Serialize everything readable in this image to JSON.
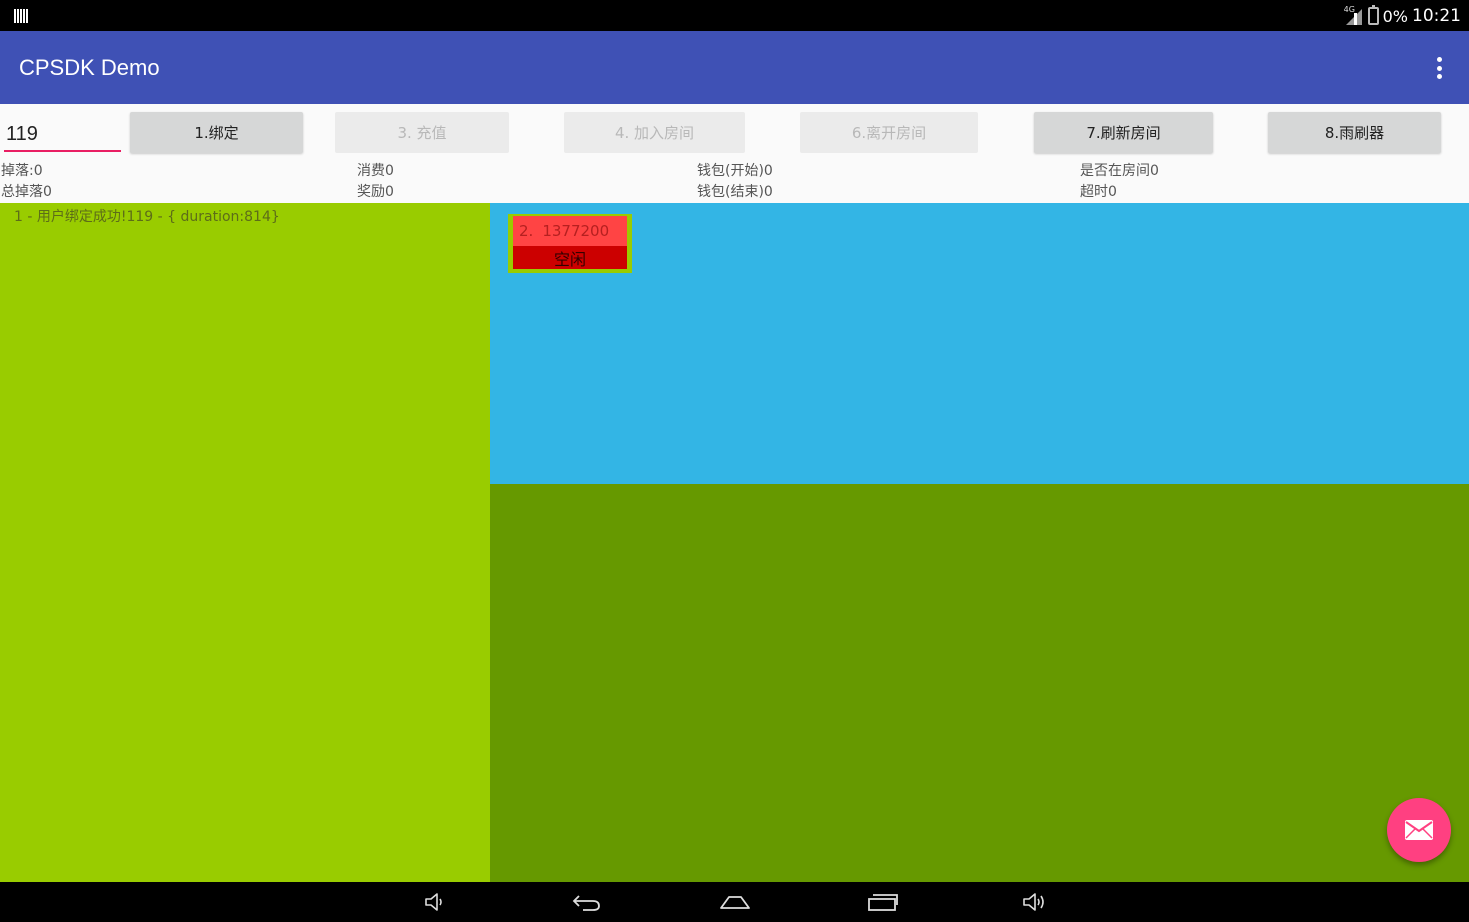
{
  "status_bar": {
    "network_label": "4G",
    "battery_text": "0%",
    "time": "10:21"
  },
  "app_bar": {
    "title": "CPSDK Demo",
    "menu_icon": "overflow-menu-icon"
  },
  "controls": {
    "user_id_value": "119",
    "buttons": [
      {
        "label": "1.绑定",
        "enabled": true
      },
      {
        "label": "3. 充值",
        "enabled": false
      },
      {
        "label": "4. 加入房间",
        "enabled": false
      },
      {
        "label": "6.离开房间",
        "enabled": false
      },
      {
        "label": "7.刷新房间",
        "enabled": true
      },
      {
        "label": "8.雨刷器",
        "enabled": true
      }
    ]
  },
  "stats": {
    "drop": "掉落:0",
    "total_drop": "总掉落0",
    "consume": "消费0",
    "reward": "奖励0",
    "wallet_start": "钱包(开始)0",
    "wallet_end": "钱包(结束)0",
    "in_room": "是否在房间0",
    "timeout": "超时0"
  },
  "log": {
    "line": "1 - 用户绑定成功!119 - { duration:814}"
  },
  "room": {
    "index": "2.",
    "id": "1377200",
    "status": "空闲"
  },
  "colors": {
    "app_bar": "#3f51b5",
    "accent": "#ff4081",
    "panel_left": "#99cc00",
    "panel_top_right": "#33b5e5",
    "panel_bottom_right": "#669900",
    "room_header": "#ff4444",
    "room_status": "#cc0000"
  },
  "fab": {
    "icon": "mail-icon"
  },
  "nav_bar": {
    "icons": [
      "volume-down-icon",
      "back-icon",
      "home-icon",
      "recent-apps-icon",
      "volume-up-icon"
    ]
  }
}
